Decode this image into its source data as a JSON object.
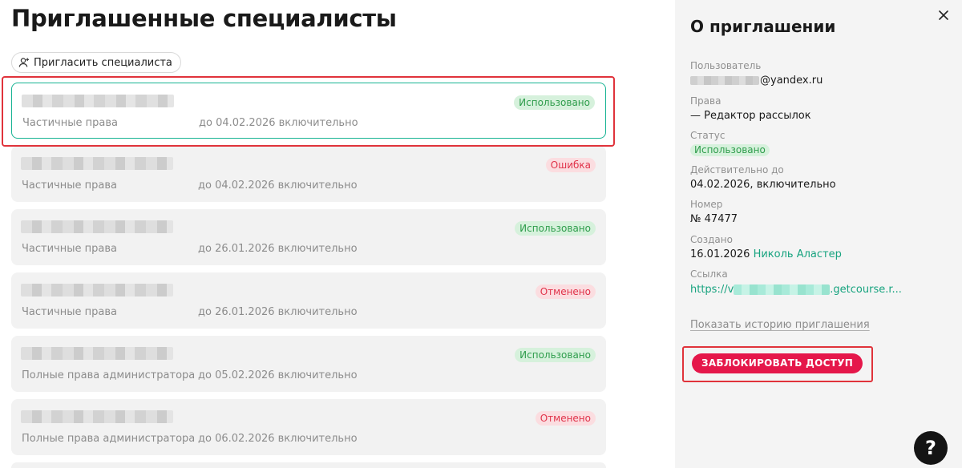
{
  "main": {
    "title": "Приглашенные специалисты",
    "invite_button_label": "Пригласить специалиста",
    "invitations": [
      {
        "rights": "Частичные права",
        "until": "до 04.02.2026 включительно",
        "status": "Использовано",
        "status_kind": "used",
        "selected": true
      },
      {
        "rights": "Частичные права",
        "until": "до 04.02.2026 включительно",
        "status": "Ошибка",
        "status_kind": "error",
        "selected": false
      },
      {
        "rights": "Частичные права",
        "until": "до 26.01.2026 включительно",
        "status": "Использовано",
        "status_kind": "used",
        "selected": false
      },
      {
        "rights": "Частичные права",
        "until": "до 26.01.2026 включительно",
        "status": "Отменено",
        "status_kind": "error",
        "selected": false
      },
      {
        "rights": "Полные права администратора",
        "until": "до 05.02.2026 включительно",
        "status": "Использовано",
        "status_kind": "used",
        "selected": false
      },
      {
        "rights": "Полные права администратора",
        "until": "до 06.02.2026 включительно",
        "status": "Отменено",
        "status_kind": "error",
        "selected": false
      }
    ]
  },
  "panel": {
    "title": "О приглашении",
    "user_label": "Пользователь",
    "user_value_suffix": "@yandex.ru",
    "rights_label": "Права",
    "rights_value": "— Редактор рассылок",
    "status_label": "Статус",
    "status_value": "Использовано",
    "valid_until_label": "Действительно до",
    "valid_until_value": "04.02.2026, включительно",
    "number_label": "Номер",
    "number_value": "№ 47477",
    "created_label": "Создано",
    "created_date": "16.01.2026",
    "created_by": "Николь Аластер",
    "link_label": "Ссылка",
    "link_prefix": "https://v",
    "link_suffix": ".getcourse.r...",
    "history_link": "Показать историю приглашения",
    "block_button": "ЗАБЛОКИРОВАТЬ ДОСТУП"
  },
  "help_button_label": "?",
  "colors": {
    "accent_green": "#17b393",
    "danger_red": "#e5174a",
    "used_badge_bg": "#d6f1dc",
    "error_badge_bg": "#fbdde0"
  },
  "icons": {
    "invite": "user-plus-icon",
    "close": "close-icon",
    "help": "question-icon"
  }
}
